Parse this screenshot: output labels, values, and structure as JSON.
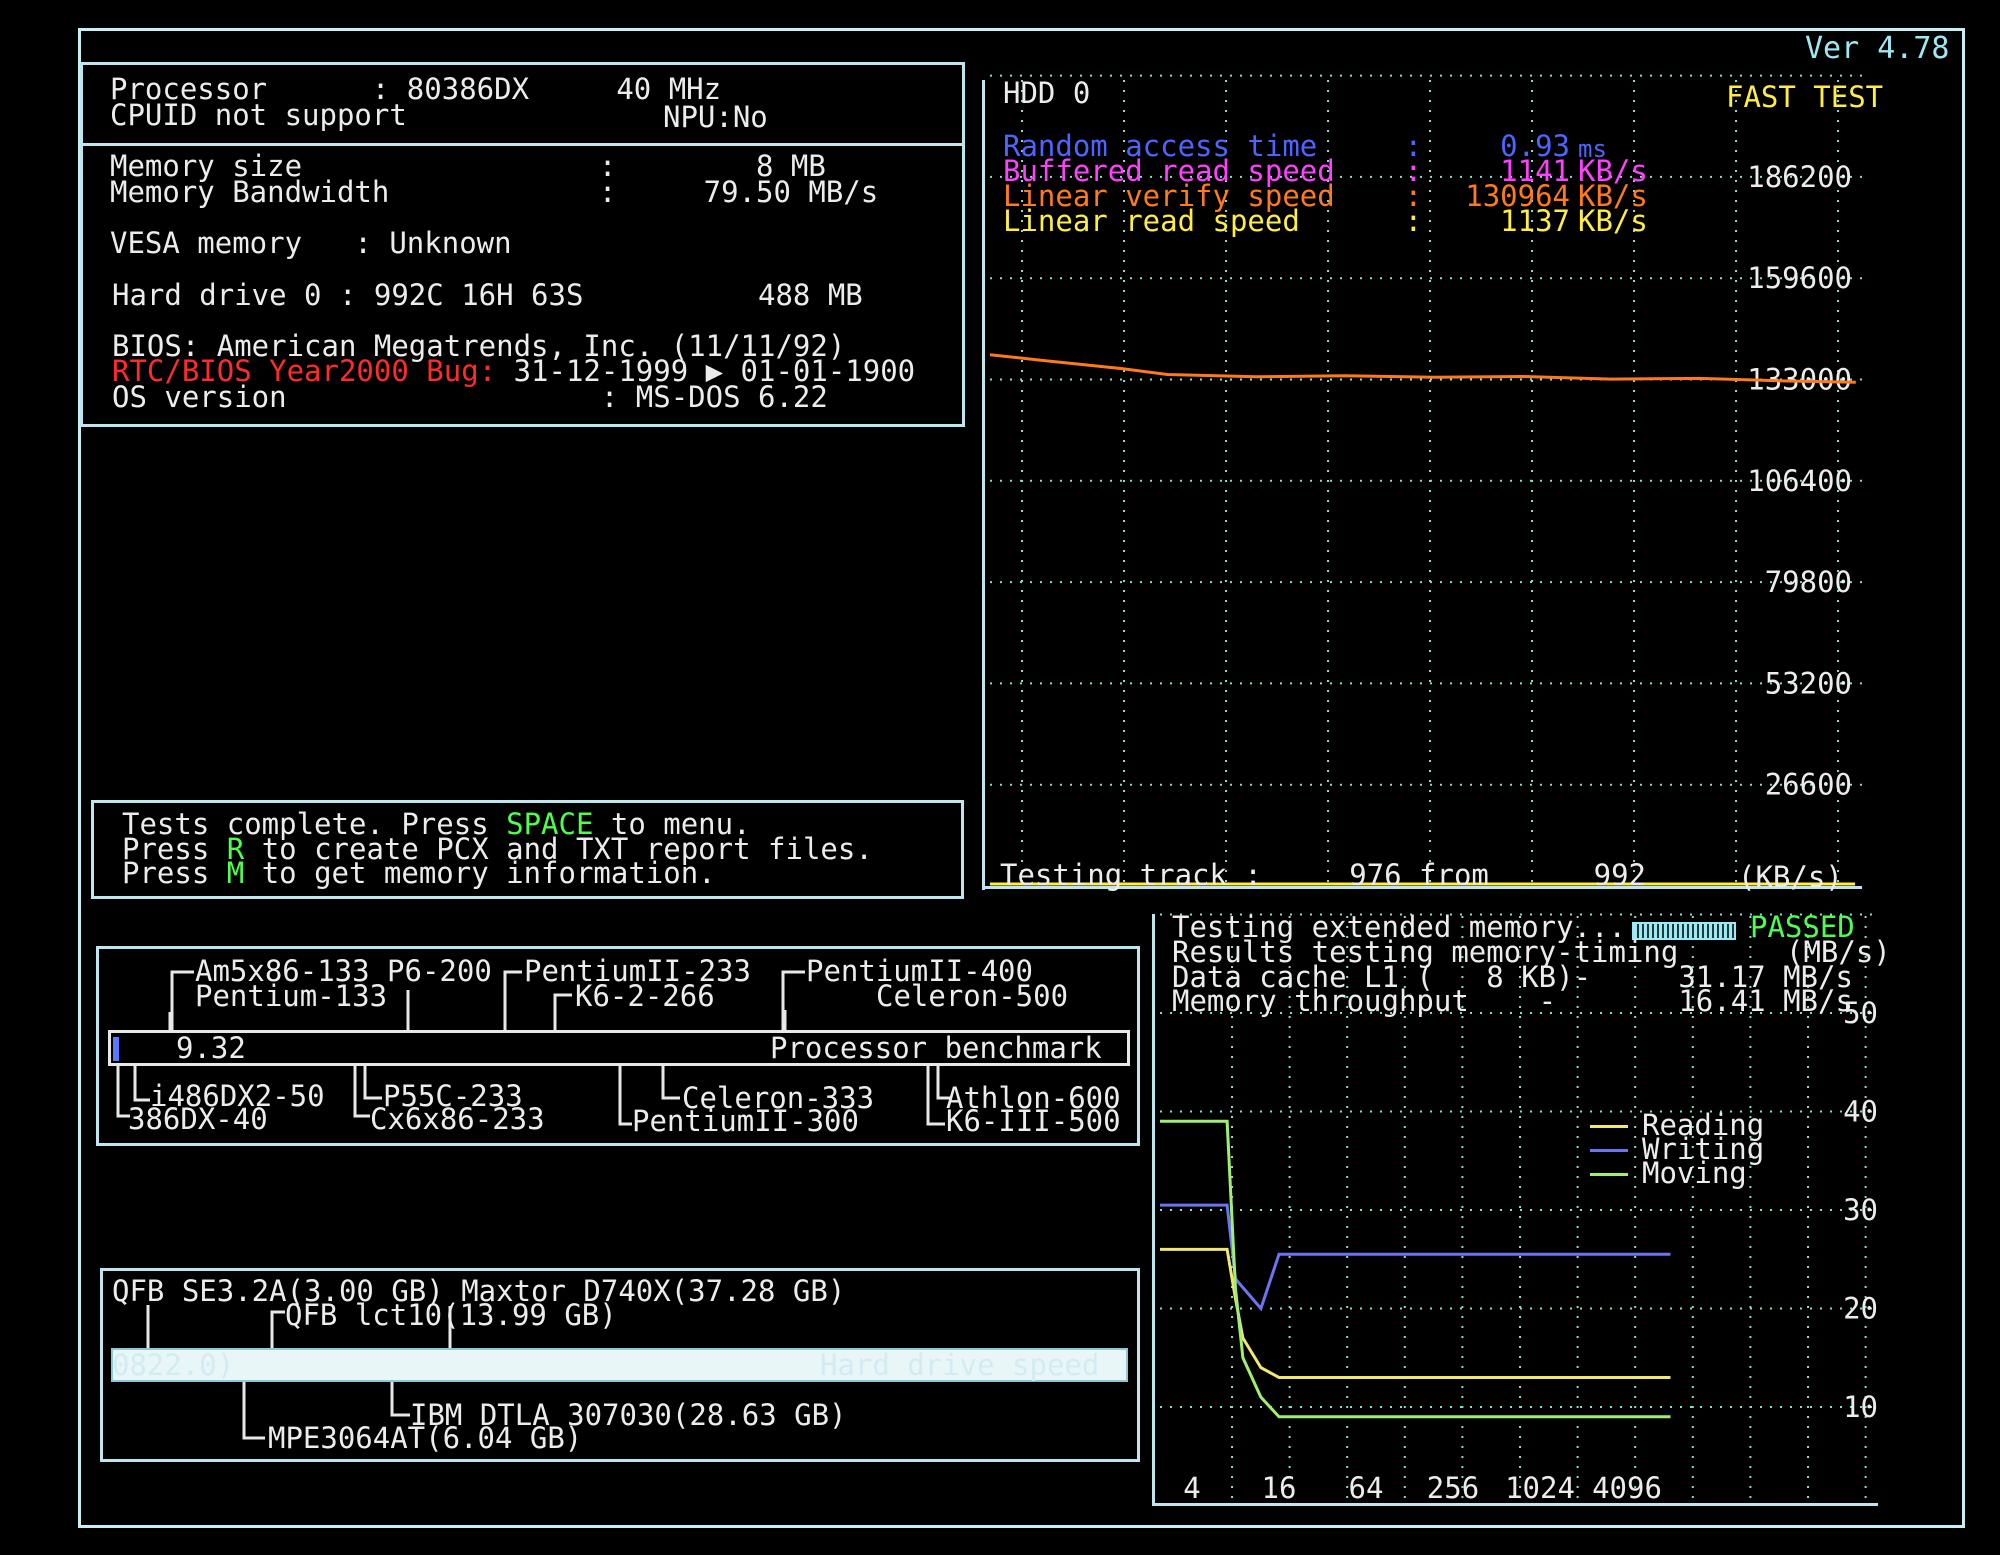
{
  "version": "Ver 4.78",
  "sysinfo": {
    "processor": "Processor      : 80386DX     40 MHz",
    "cpuid": "CPUID not support",
    "npu": "NPU:No",
    "mem_size": "Memory size                 :        8 MB",
    "mem_bw": "Memory Bandwidth            :     79.50 MB/s",
    "vesa": "VESA memory   : Unknown",
    "hdd": "Hard drive 0 : 992C 16H 63S          488 MB",
    "bios": "BIOS: American Megatrends, Inc. (11/11/92)",
    "rtc_label": "RTC/BIOS Year2000 Bug:",
    "rtc_value": " 31-12-1999 ▶ 01-01-1900",
    "os": "OS version                  : MS-DOS 6.22"
  },
  "messages": {
    "line1_a": "Tests complete. Press ",
    "line1_key": "SPACE",
    "line1_b": " to menu.",
    "line2_a": "Press ",
    "line2_key": "R",
    "line2_b": " to create PCX and TXT report files.",
    "line3_a": "Press ",
    "line3_key": "M",
    "line3_b": " to get memory information."
  },
  "hdd_panel": {
    "title": "HDD 0",
    "mode": "FAST TEST",
    "stats": [
      {
        "label": "Random access time     :",
        "value": "0.93",
        "unit": "ms",
        "color": "#4d64ff"
      },
      {
        "label": "Buffered read speed    :",
        "value": "1141",
        "unit": "KB/s",
        "color": "#ff40ff"
      },
      {
        "label": "Linear verify speed    :",
        "value": "130964",
        "unit": "KB/s",
        "color": "#ff7a1a"
      },
      {
        "label": "Linear read speed      :",
        "value": "1137",
        "unit": "KB/s",
        "color": "#ffee40"
      }
    ],
    "y_ticks": [
      "186200",
      "159600",
      "133000",
      "106400",
      "79800",
      "53200",
      "26600"
    ],
    "status": "Testing track :     976 from      992",
    "unit_label": "(KB/s)"
  },
  "cpu_bench": {
    "value": "9.32",
    "label": "Processor benchmark",
    "top_refs": [
      "Am5x86-133 P6-200",
      "Pentium-133",
      "PentiumII-233",
      "K6-2-266",
      "PentiumII-400",
      "Celeron-500"
    ],
    "bottom_refs": [
      "i486DX2-50",
      "386DX-40",
      "P55C-233",
      "Cx6x86-233",
      "Celeron-333",
      "PentiumII-300",
      "Athlon-600",
      "K6-III-500"
    ]
  },
  "hdd_bench": {
    "value": "0822.0)",
    "label": "Hard drive speed",
    "top_refs": [
      "QFB SE3.2A(3.00 GB) Maxtor D740X(37.28 GB)",
      "QFB lct10(13.99 GB)"
    ],
    "bottom_refs": [
      "IBM DTLA 307030(28.63 GB)",
      "MPE3064AT(6.04 GB)"
    ]
  },
  "mem_panel": {
    "line1": "Testing extended memory...",
    "passed": "PASSED",
    "line2": "Results testing memory-timing",
    "unit": "(MB/s)",
    "line3": "Data cache L1 (   8 KB)-     31.17 MB/s",
    "line4": "Memory throughput    -       16.41 MB/s",
    "legend": [
      {
        "name": "Reading",
        "color": "#f2e870"
      },
      {
        "name": "Writing",
        "color": "#6d74f0"
      },
      {
        "name": "Moving",
        "color": "#9ff070"
      }
    ]
  },
  "chart_data": [
    {
      "type": "line",
      "title": "HDD 0",
      "ylabel": "(KB/s)",
      "ylim": [
        0,
        186200
      ],
      "y_ticks": [
        26600,
        53200,
        79800,
        106400,
        133000,
        159600,
        186200
      ],
      "xlim": [
        0,
        992
      ],
      "series": [
        {
          "name": "Linear verify speed",
          "color": "#ff7a1a",
          "x": [
            0,
            60,
            150,
            200,
            300,
            400,
            500,
            600,
            700,
            800,
            900,
            976
          ],
          "values": [
            139500,
            138000,
            135800,
            134300,
            133700,
            134000,
            133600,
            133800,
            133100,
            133300,
            132600,
            132300
          ]
        }
      ]
    },
    {
      "type": "line",
      "ylabel": "(MB/s)",
      "ylim": [
        0,
        50
      ],
      "y_ticks": [
        10,
        20,
        30,
        40,
        50
      ],
      "x_ticks": [
        "4",
        "16",
        "64",
        "256",
        "1024",
        "4096"
      ],
      "series": [
        {
          "name": "Reading",
          "color": "#f2e870",
          "x": [
            2,
            7,
            8,
            9,
            12,
            16,
            4096,
            8192
          ],
          "values": [
            26,
            26,
            21,
            17,
            14,
            13,
            13,
            13
          ]
        },
        {
          "name": "Writing",
          "color": "#6d74f0",
          "x": [
            2,
            7,
            8,
            12,
            16,
            4096,
            8192
          ],
          "values": [
            30.5,
            30.5,
            23,
            20,
            25.5,
            25.5,
            25.5
          ]
        },
        {
          "name": "Moving",
          "color": "#9ff070",
          "x": [
            2,
            7,
            8,
            9,
            12,
            16,
            4096,
            8192
          ],
          "values": [
            39,
            39,
            22,
            15,
            11,
            9,
            9,
            9
          ]
        }
      ]
    }
  ]
}
